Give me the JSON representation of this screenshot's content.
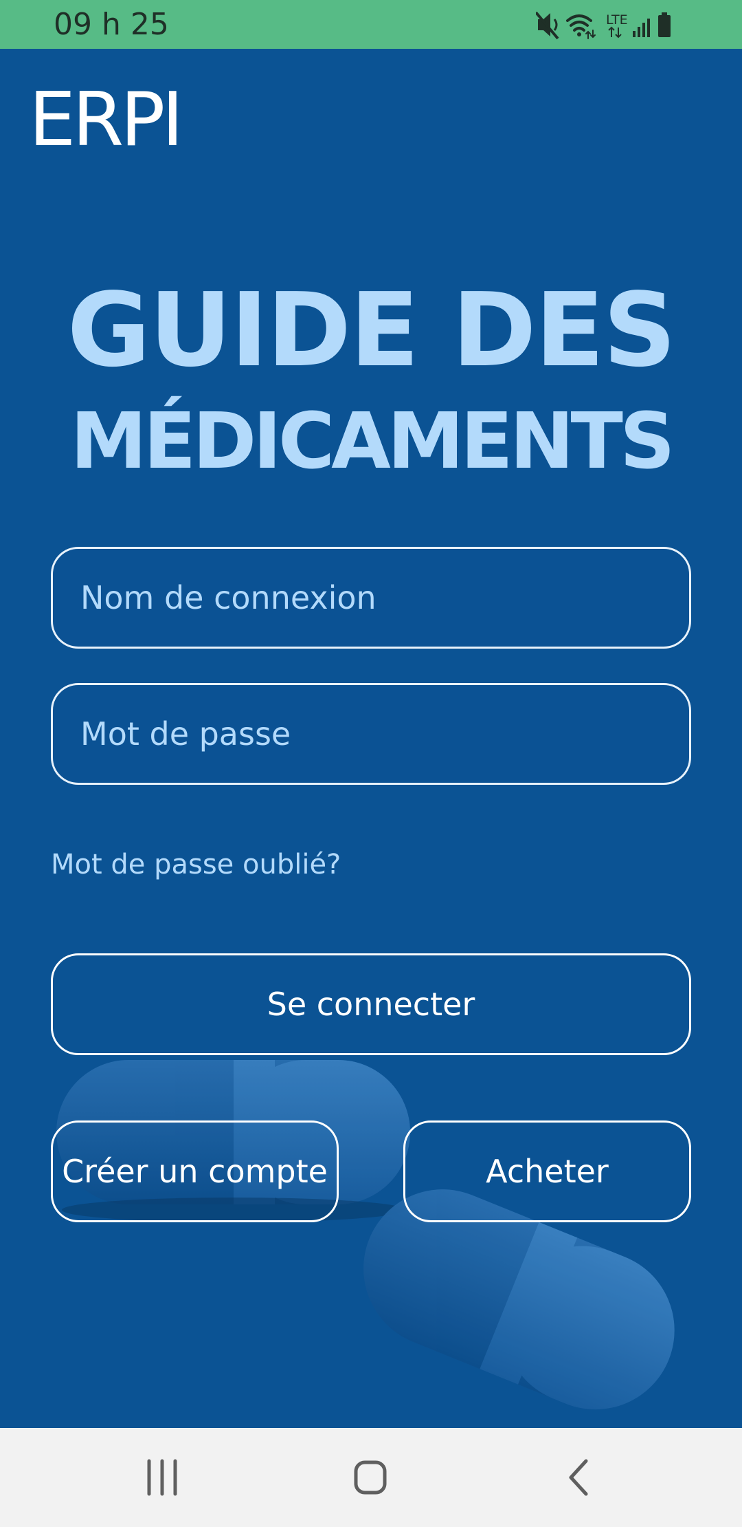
{
  "status_bar": {
    "time": "09 h 25",
    "network_label": "LTE",
    "icons": [
      "mute-icon",
      "wifi-icon",
      "lte-data-icon",
      "signal-icon",
      "battery-icon"
    ],
    "background": "#57bb86"
  },
  "app": {
    "logo": "ERPI",
    "headline_line1": "GUIDE DES",
    "headline_line2": "MÉDICAMENTS",
    "background": "#0b5394",
    "accent": "#b3dafb"
  },
  "login_form": {
    "username_placeholder": "Nom de connexion",
    "password_placeholder": "Mot de passe",
    "forgot_password": "Mot de passe oublié?",
    "connect_label": "Se connecter",
    "create_account_label": "Créer un compte",
    "buy_label": "Acheter"
  },
  "nav_bar": {
    "icons": [
      "recent-apps-icon",
      "home-icon",
      "back-icon"
    ]
  }
}
